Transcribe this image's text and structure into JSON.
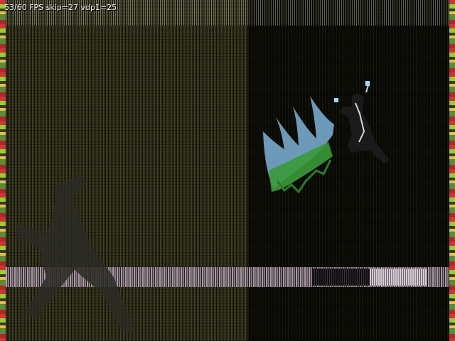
{
  "hud": {
    "stats_text": "53/60 FPS skip=27 vdp1=25"
  },
  "scene": {
    "sprites": [
      {
        "kind": "enemy",
        "icon": "winged-creature-sprite",
        "colors": [
          "#7fb3d9",
          "#3a9a3a"
        ]
      },
      {
        "kind": "player",
        "icon": "dark-warrior-sprite",
        "colors": [
          "#1a1a1a",
          "#9fd8ff"
        ]
      }
    ],
    "shadow_icon": "shadow-figure-icon"
  },
  "colors": {
    "left_panel": "#6b6a4e",
    "right_panel": "#3b3b2c",
    "edge_red": "#c8383a",
    "edge_green": "#9acd32",
    "hud_text": "#f0f0f0"
  }
}
